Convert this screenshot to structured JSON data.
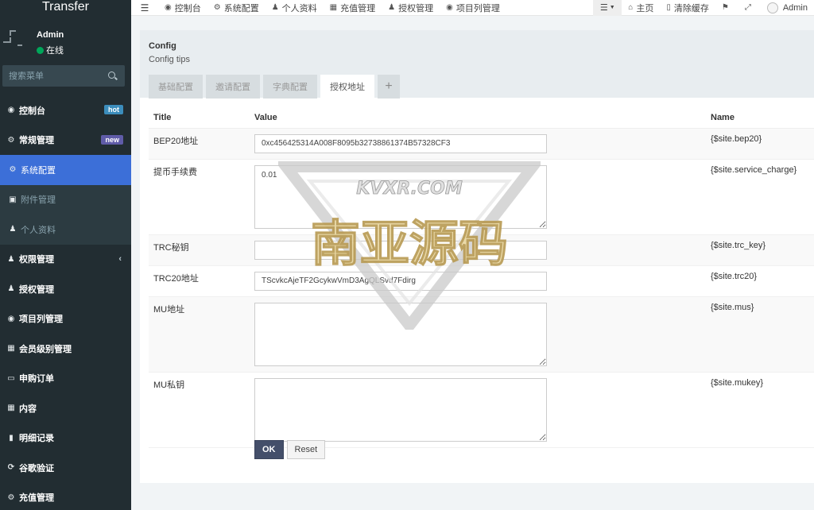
{
  "brand": "Transfer",
  "user": {
    "name": "Admin",
    "status": "在线"
  },
  "search": {
    "placeholder": "搜索菜单"
  },
  "sidebar": {
    "items": [
      {
        "label": "控制台",
        "icon": "dashboard-icon",
        "glyph": "◉",
        "badge": "hot"
      },
      {
        "label": "常规管理",
        "icon": "cogs-icon",
        "glyph": "⚙",
        "badge": "new"
      }
    ],
    "submenu": [
      {
        "label": "系统配置",
        "icon": "gear-icon",
        "glyph": "⚙"
      },
      {
        "label": "附件管理",
        "icon": "file-image-icon",
        "glyph": "▣"
      },
      {
        "label": "个人资料",
        "icon": "user-icon",
        "glyph": "♟"
      }
    ],
    "more": [
      {
        "label": "权限管理",
        "icon": "group-icon",
        "glyph": "♟"
      },
      {
        "label": "授权管理",
        "icon": "users-icon",
        "glyph": "♟"
      },
      {
        "label": "项目列管理",
        "icon": "circle-icon",
        "glyph": "◉"
      },
      {
        "label": "会员级别管理",
        "icon": "calendar-icon",
        "glyph": "▦"
      },
      {
        "label": "申购订单",
        "icon": "card-icon",
        "glyph": "▭"
      },
      {
        "label": "内容",
        "icon": "grid-icon",
        "glyph": "▦"
      },
      {
        "label": "明细记录",
        "icon": "bar-chart-icon",
        "glyph": "▮"
      },
      {
        "label": "谷歌验证",
        "icon": "refresh-icon",
        "glyph": "⟳"
      },
      {
        "label": "充值管理",
        "icon": "gear-icon",
        "glyph": "⚙"
      }
    ]
  },
  "topbar": {
    "items": [
      {
        "label": "控制台",
        "icon": "dashboard-icon",
        "glyph": "◉"
      },
      {
        "label": "系统配置",
        "icon": "gear-icon",
        "glyph": "⚙"
      },
      {
        "label": "个人资料",
        "icon": "user-icon",
        "glyph": "♟"
      },
      {
        "label": "充值管理",
        "icon": "calendar-icon",
        "glyph": "▦"
      },
      {
        "label": "授权管理",
        "icon": "users-icon",
        "glyph": "♟"
      },
      {
        "label": "项目列管理",
        "icon": "circle-icon",
        "glyph": "◉"
      }
    ],
    "home": "主页",
    "clear_cache": "清除缓存",
    "admin": "Admin"
  },
  "panel": {
    "title": "Config",
    "tips": "Config tips",
    "tabs": [
      "基础配置",
      "邀请配置",
      "字典配置",
      "授权地址"
    ],
    "active_tab": 3
  },
  "table": {
    "headers": {
      "title": "Title",
      "value": "Value",
      "name": "Name"
    },
    "rows": [
      {
        "title": "BEP20地址",
        "type": "input",
        "value": "0xc456425314A008F8095b32738861374B57328CF3",
        "name": "{$site.bep20}"
      },
      {
        "title": "提币手续费",
        "type": "textarea",
        "value": "0.01",
        "name": "{$site.service_charge}"
      },
      {
        "title": "TRC秘钥",
        "type": "input",
        "value": "",
        "name": "{$site.trc_key}"
      },
      {
        "title": "TRC20地址",
        "type": "input",
        "value": "TScvkcAjeTF2GcykwVmD3AgQLSvd7Fdirg",
        "name": "{$site.trc20}"
      },
      {
        "title": "MU地址",
        "type": "textarea",
        "value": "",
        "name": "{$site.mus}"
      },
      {
        "title": "MU私钥",
        "type": "textarea",
        "value": "",
        "name": "{$site.mukey}"
      }
    ]
  },
  "buttons": {
    "ok": "OK",
    "reset": "Reset"
  },
  "watermark": {
    "line1": "KVXR.COM",
    "line2": "南亚源码"
  },
  "colors": {
    "sidebar_bg": "#222d32",
    "active_item": "#3c6fd8",
    "ok_button": "#444f6a"
  }
}
